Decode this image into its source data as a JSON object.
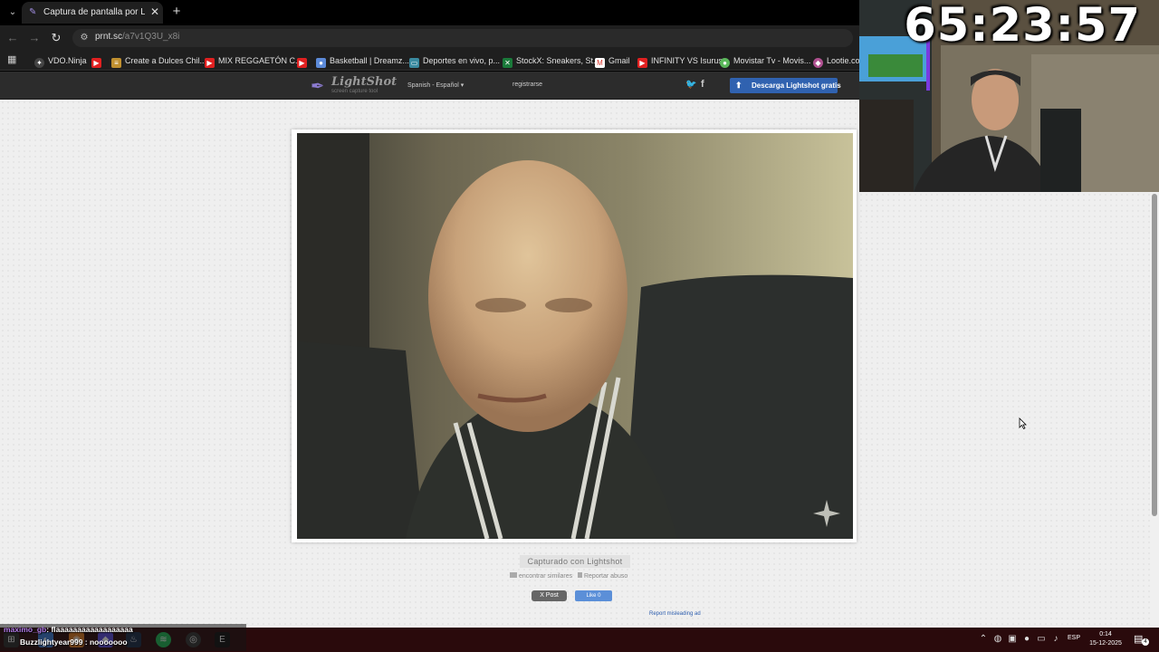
{
  "browser": {
    "tab_title": "Captura de pantalla por Lightshot",
    "close_glyph": "✕",
    "new_tab_glyph": "+",
    "menu_glyph": "⌄",
    "url_host": "prnt.sc",
    "url_path": "/a7v1Q3U_x8i"
  },
  "bookmarks": [
    {
      "label": "VDO.Ninja",
      "icon": "vdo-ninja-icon",
      "color": "#444444"
    },
    {
      "label": "",
      "icon": "youtube-icon",
      "color": "#e02020"
    },
    {
      "label": "Create a Dulces Chil...",
      "icon": "document-icon",
      "color": "#c09030"
    },
    {
      "label": "MIX REGGAETÓN C...",
      "icon": "youtube-icon",
      "color": "#e02020"
    },
    {
      "label": "",
      "icon": "youtube-icon",
      "color": "#e02020"
    },
    {
      "label": "Basketball | Dreamz...",
      "icon": "basketball-icon",
      "color": "#5c8ad8"
    },
    {
      "label": "Deportes en vivo, p...",
      "icon": "tv-icon",
      "color": "#3a8aa0"
    },
    {
      "label": "StockX: Sneakers, St...",
      "icon": "stockx-icon",
      "color": "#1a7a3a"
    },
    {
      "label": "Gmail",
      "icon": "gmail-icon",
      "color": "#d93025"
    },
    {
      "label": "INFINITY VS Isurus",
      "icon": "youtube-icon",
      "color": "#e02020"
    },
    {
      "label": "Movistar Tv - Movis...",
      "icon": "movistar-icon",
      "color": "#5bb85b"
    },
    {
      "label": "Lootie.com",
      "icon": "lootie-icon",
      "color": "#b05090"
    }
  ],
  "lightshot": {
    "brand": "LightShot",
    "tagline": "screen capture tool",
    "language": "Spanish - Español",
    "register": "registrarse",
    "download": "Descarga Lightshot gratis",
    "captured_label": "Capturado con Lightshot",
    "find_similar": "encontrar similares",
    "report_abuse": "Reportar abuso",
    "x_post": "X Post",
    "fb_like": "Like 0",
    "report_ad": "Report misleading ad"
  },
  "overlay": {
    "timer": "65:23:57",
    "chat": [
      {
        "user": "maximo_gb",
        "message": ": flaaaaaaaaaaaaaaaaaa"
      },
      {
        "user": "",
        "message": "Buzzlightyear999 : nooooooo"
      }
    ]
  },
  "taskbar": {
    "language": "ESP",
    "time": "0:14",
    "date": "15-12-2025",
    "notifications": "4"
  }
}
